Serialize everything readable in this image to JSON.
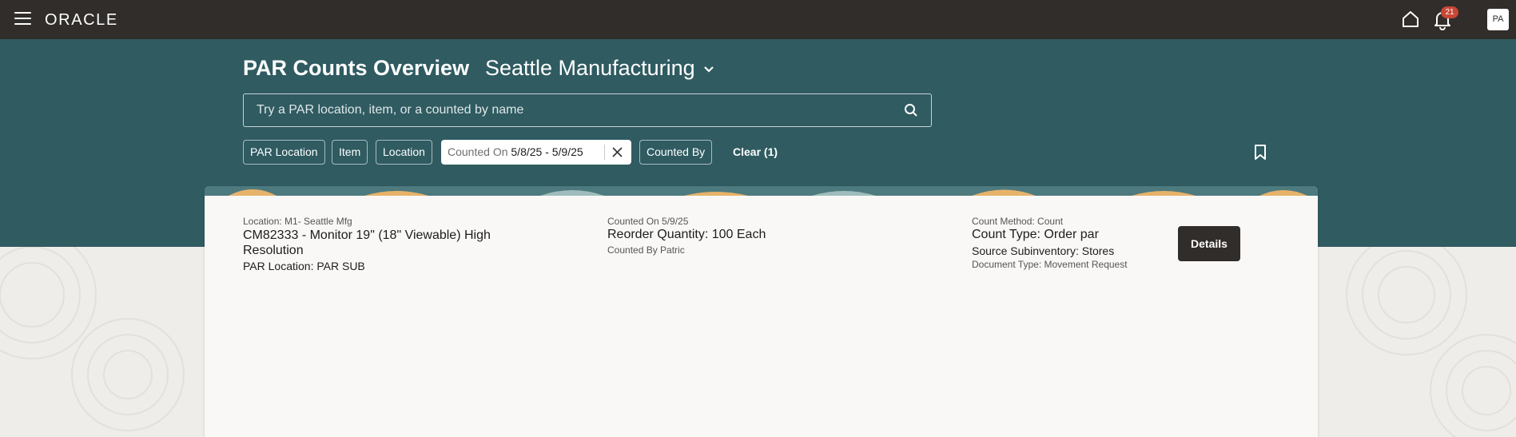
{
  "header": {
    "logo_text": "ORACLE",
    "notification_count": "21",
    "avatar_initials": "PA"
  },
  "page": {
    "title": "PAR Counts Overview",
    "site": "Seattle Manufacturing"
  },
  "search": {
    "placeholder": "Try a PAR location, item, or a counted by name"
  },
  "filters": {
    "par_location": "PAR Location",
    "item": "Item",
    "location": "Location",
    "counted_on_label": "Counted On",
    "counted_on_value": "5/8/25 - 5/9/25",
    "counted_by": "Counted By",
    "clear": "Clear (1)"
  },
  "result": {
    "location": "Location: M1- Seattle Mfg",
    "item": "CM82333 - Monitor 19\" (18\" Viewable) High Resolution",
    "par_location": "PAR Location: PAR SUB",
    "counted_on": "Counted On 5/9/25",
    "reorder_quantity": "Reorder Quantity: 100 Each",
    "counted_by": "Counted By Patric",
    "count_method": "Count Method: Count",
    "count_type": "Count Type: Order par",
    "source_subinventory": "Source Subinventory: Stores",
    "document_type": "Document Type: Movement Request",
    "details_label": "Details"
  },
  "colors": {
    "topbar": "#312d2a",
    "hero": "#2f5b61",
    "badge": "#c74634",
    "card": "#f9f8f6"
  }
}
